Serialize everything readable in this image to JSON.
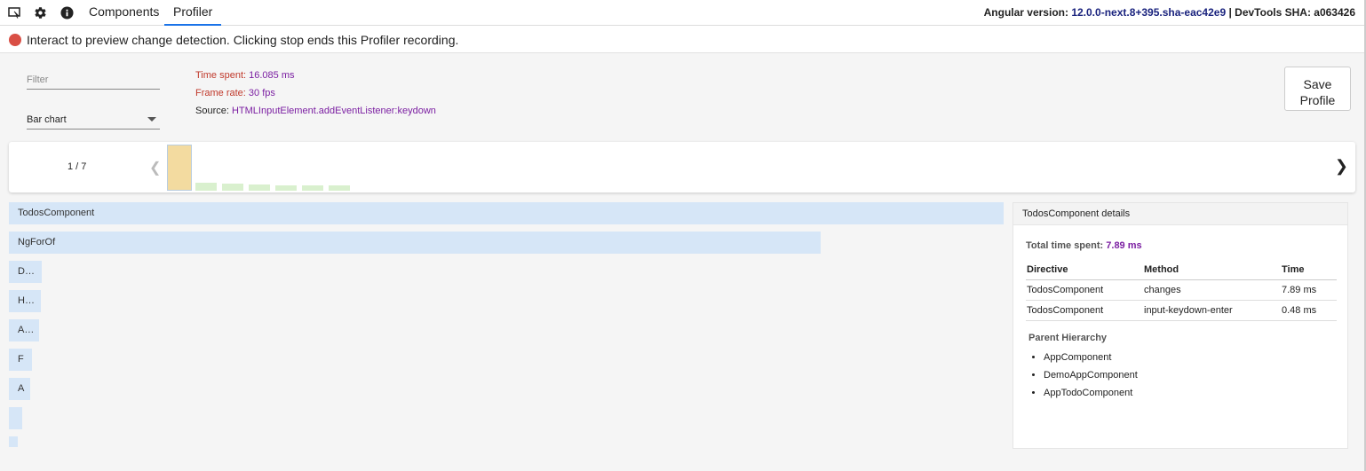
{
  "toolbar": {
    "tabs": [
      {
        "label": "Components"
      },
      {
        "label": "Profiler"
      }
    ],
    "version_label": "Angular version:",
    "version": "12.0.0-next.8+395.sha-eac42e9",
    "sha_label": "| DevTools SHA: a063426"
  },
  "banner": {
    "text": "Interact to preview change detection. Clicking stop ends this Profiler recording."
  },
  "controls": {
    "filter_placeholder": "Filter",
    "chart_type": "Bar chart",
    "save_label": "Save Profile"
  },
  "info": {
    "time_label": "Time spent:",
    "time_value": "16.085 ms",
    "frame_label": "Frame rate:",
    "frame_value": "30 fps",
    "source_label": "Source:",
    "source_value": "HTMLInputElement.addEventListener:keydown"
  },
  "navigator": {
    "frame_count": "1 / 7",
    "frames": [
      {
        "level": 1.0,
        "selected": true
      },
      {
        "level": 0.18
      },
      {
        "level": 0.16
      },
      {
        "level": 0.14
      },
      {
        "level": 0.1
      },
      {
        "level": 0.1
      },
      {
        "level": 0.1
      }
    ],
    "colors": {
      "selected": "#f3dba0",
      "frame": "#d9f0ce"
    }
  },
  "flame": {
    "bars": [
      {
        "label": "TodosComponent",
        "share": 1.0
      },
      {
        "label": "NgForOf",
        "share": 0.816
      },
      {
        "label": "D…",
        "share": 0.033
      },
      {
        "label": "H…",
        "share": 0.032
      },
      {
        "label": "A…",
        "share": 0.03
      },
      {
        "label": "F",
        "share": 0.023
      },
      {
        "label": "A",
        "share": 0.021
      },
      {
        "label": "",
        "share": 0.013
      },
      {
        "label": "",
        "share": 0.003
      }
    ],
    "color": "#d6e6f7"
  },
  "details": {
    "title": "TodosComponent details",
    "total_label": "Total time spent:",
    "total_value": "7.89 ms",
    "columns": [
      "Directive",
      "Method",
      "Time"
    ],
    "rows": [
      [
        "TodosComponent",
        "changes",
        "7.89 ms"
      ],
      [
        "TodosComponent",
        "input-keydown-enter",
        "0.48 ms"
      ]
    ],
    "parent_title": "Parent Hierarchy",
    "parents": [
      "AppComponent",
      "DemoAppComponent",
      "AppTodoComponent"
    ]
  },
  "icons": {
    "inspect": "inspect-element-icon",
    "settings": "gear-icon",
    "info": "info-icon",
    "record": "record-dot-icon",
    "prev": "chevron-left-icon",
    "next": "chevron-right-icon",
    "caret": "caret-down-icon"
  }
}
